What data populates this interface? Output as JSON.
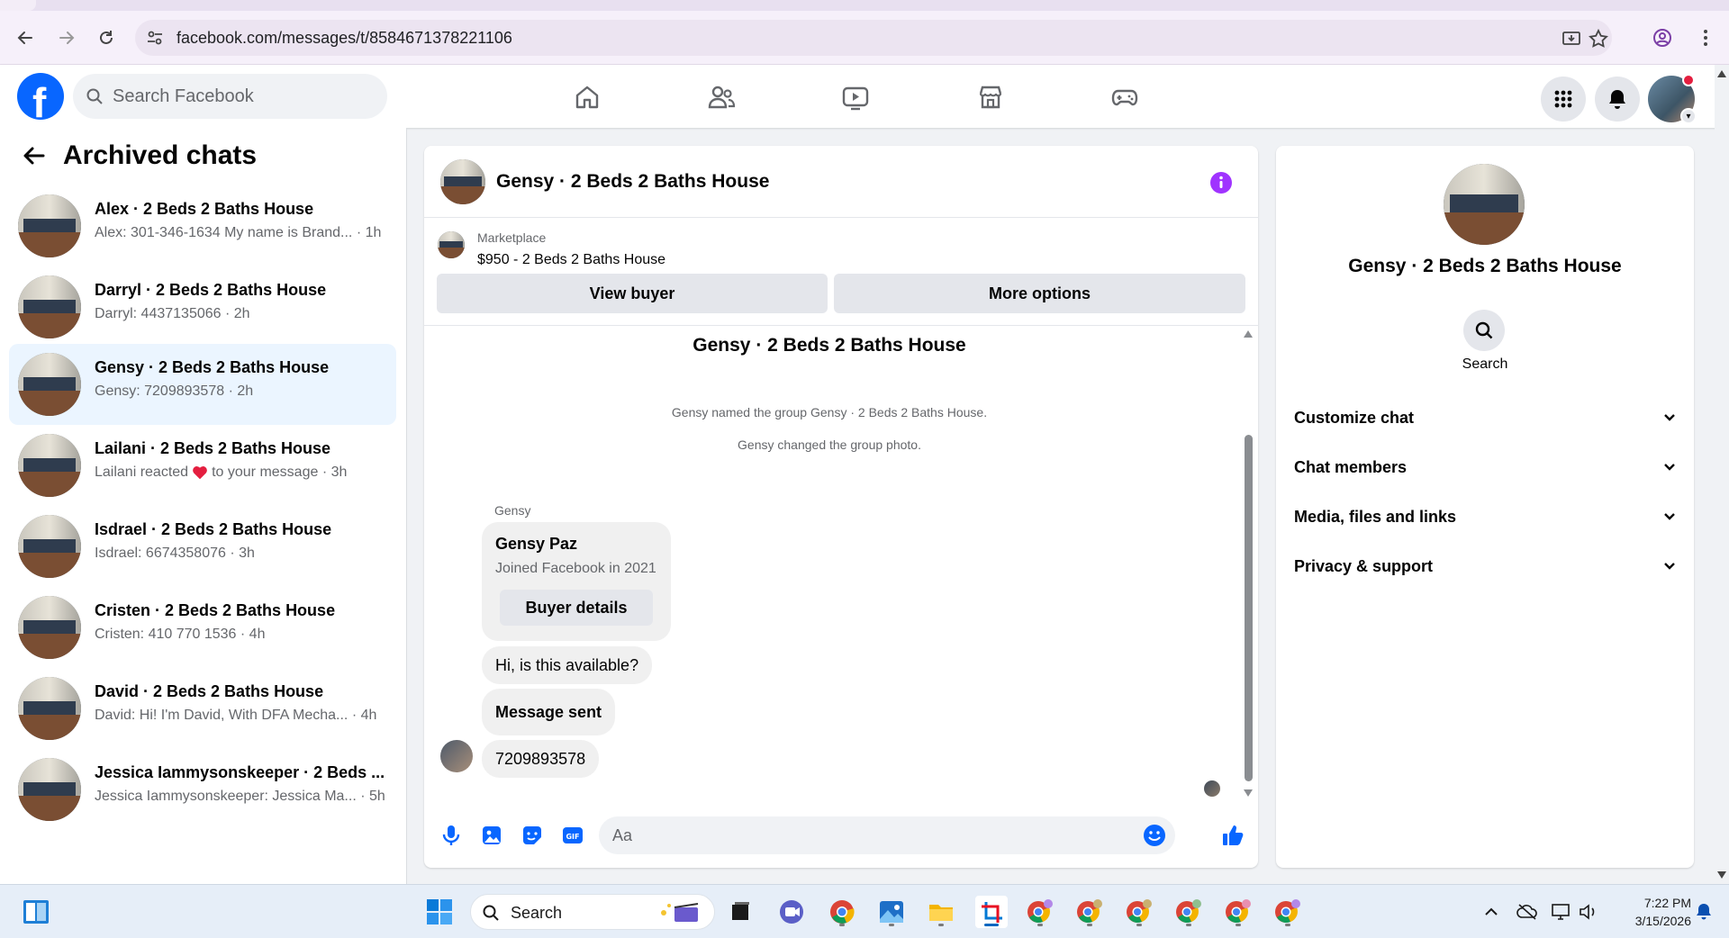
{
  "browser": {
    "url": "facebook.com/messages/t/8584671378221106"
  },
  "header": {
    "search_placeholder": "Search Facebook"
  },
  "sidebar": {
    "title": "Archived chats",
    "chats": [
      {
        "name": "Alex · 2 Beds 2 Baths House",
        "preview": "Alex: 301-346-1634 My name is Brand...",
        "time": "· 1h"
      },
      {
        "name": "Darryl · 2 Beds 2 Baths House",
        "preview": "Darryl: 4437135066",
        "time": "· 2h"
      },
      {
        "name": "Gensy · 2 Beds 2 Baths House",
        "preview": "Gensy: 7209893578",
        "time": "· 2h"
      },
      {
        "name": "Lailani · 2 Beds 2 Baths House",
        "preview_before": "Lailani reacted",
        "preview_after": "to your message",
        "time": "· 3h"
      },
      {
        "name": "Isdrael · 2 Beds 2 Baths House",
        "preview": "Isdrael: 6674358076",
        "time": "· 3h"
      },
      {
        "name": "Cristen · 2 Beds 2 Baths House",
        "preview": "Cristen: 410 770 1536",
        "time": "· 4h"
      },
      {
        "name": "David · 2 Beds 2 Baths House",
        "preview": "David: Hi! I'm David, With DFA Mecha...",
        "time": "· 4h"
      },
      {
        "name": "Jessica Iammysonskeeper · 2 Beds ...",
        "preview": "Jessica Iammysonskeeper: Jessica Ma...",
        "time": "· 5h"
      }
    ]
  },
  "conversation": {
    "title": "Gensy · 2 Beds 2 Baths House",
    "marketplace_label": "Marketplace",
    "listing": "$950 - 2 Beds 2 Baths House",
    "view_buyer": "View buyer",
    "more_options": "More options",
    "group_title": "Gensy · 2 Beds 2 Baths House",
    "system_messages": [
      "Gensy named the group Gensy · 2 Beds 2 Baths House.",
      "Gensy changed the group photo."
    ],
    "sender": "Gensy",
    "card": {
      "name": "Gensy Paz",
      "joined": "Joined Facebook in 2021",
      "button": "Buyer details"
    },
    "messages": [
      "Hi, is this available?",
      "Message sent",
      "7209893578"
    ],
    "composer_placeholder": "Aa"
  },
  "right_panel": {
    "name": "Gensy · 2 Beds 2 Baths House",
    "search_label": "Search",
    "sections": [
      "Customize chat",
      "Chat members",
      "Media, files and links",
      "Privacy & support"
    ]
  },
  "taskbar": {
    "search_label": "Search",
    "time": "7:22 PM",
    "date": "3/15/2026"
  },
  "colors": {
    "brand": "#0866ff",
    "active_chat": "#ebf5ff",
    "accent_purple": "#a033ff"
  }
}
